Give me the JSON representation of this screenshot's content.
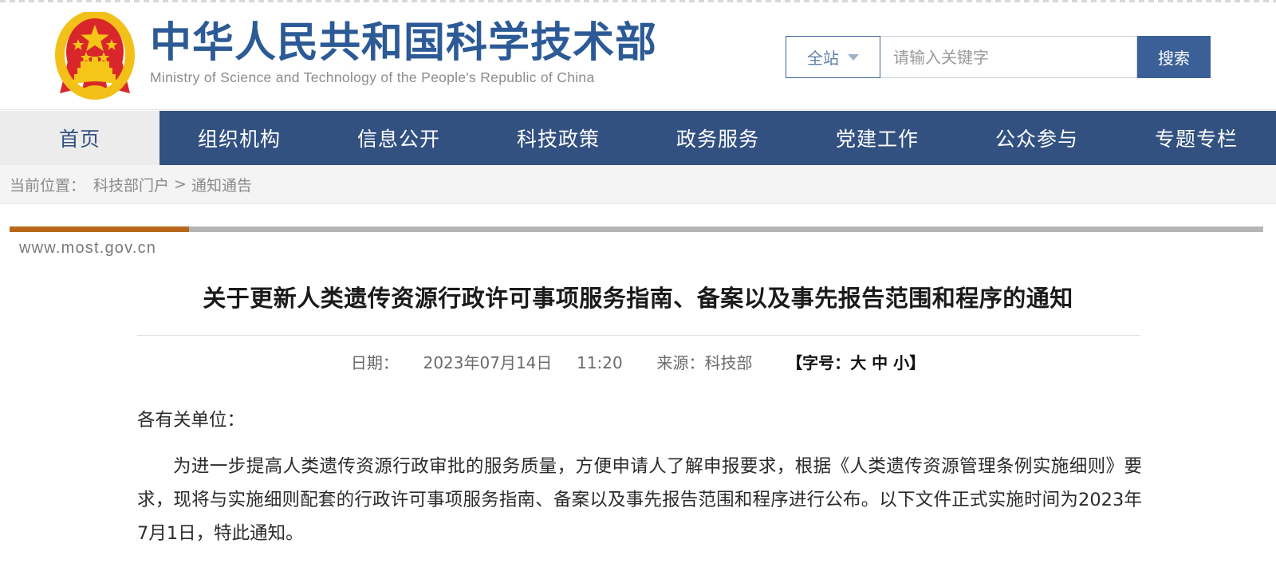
{
  "header": {
    "emblem_name": "china-national-emblem",
    "logo_cn": "中华人民共和国科学技术部",
    "logo_en": "Ministry of Science and Technology of the People's Republic of China"
  },
  "search": {
    "scope_label": "全站",
    "placeholder": "请输入关键字",
    "value": "",
    "button_label": "搜索"
  },
  "nav": {
    "items": [
      {
        "label": "首页",
        "active": true
      },
      {
        "label": "组织机构",
        "active": false
      },
      {
        "label": "信息公开",
        "active": false
      },
      {
        "label": "科技政策",
        "active": false
      },
      {
        "label": "政务服务",
        "active": false
      },
      {
        "label": "党建工作",
        "active": false
      },
      {
        "label": "公众参与",
        "active": false
      },
      {
        "label": "专题专栏",
        "active": false
      }
    ]
  },
  "breadcrumb": {
    "prefix": "当前位置：",
    "root": "科技部门户",
    "separator": ">",
    "current": "通知通告"
  },
  "site": {
    "url": "www.most.gov.cn"
  },
  "article": {
    "title": "关于更新人类遗传资源行政许可事项服务指南、备案以及事先报告范围和程序的通知",
    "meta": {
      "date_label": "日期：",
      "date": "2023年07月14日",
      "time": "11:20",
      "source_label": "来源：",
      "source": "科技部",
      "fontsize_open": "【字号：",
      "fontsize_large": "大",
      "fontsize_medium": "中",
      "fontsize_small": "小",
      "fontsize_close": "】"
    },
    "salutation": "各有关单位：",
    "paragraph1": "为进一步提高人类遗传资源行政审批的服务质量，方便申请人了解申报要求，根据《人类遗传资源管理条例实施细则》要求，现将与实施细则配套的行政许可事项服务指南、备案以及事先报告范围和程序进行公布。以下文件正式实施时间为2023年7月1日，特此通知。"
  },
  "colors": {
    "nav_blue": "#325181",
    "logo_blue": "#2c5a96",
    "accent_orange": "#b8681a",
    "bar_grey": "#b5b5b5",
    "search_button": "#3b6098"
  }
}
